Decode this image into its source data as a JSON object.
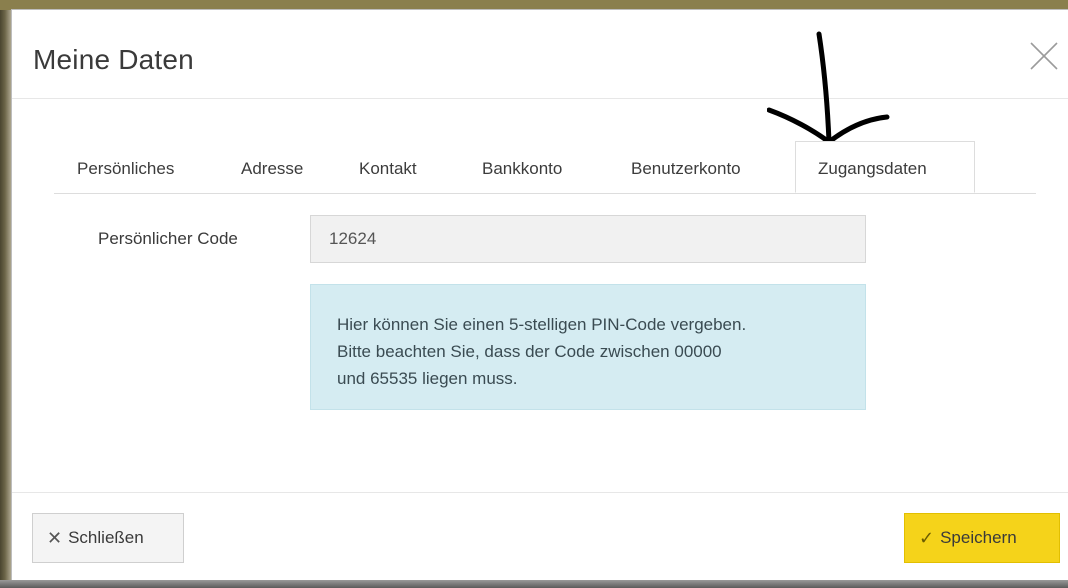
{
  "dialog": {
    "title": "Meine Daten",
    "close_icon": "close-icon"
  },
  "tabs": [
    {
      "label": "Persönliches",
      "active": false
    },
    {
      "label": "Adresse",
      "active": false
    },
    {
      "label": "Kontakt",
      "active": false
    },
    {
      "label": "Bankkonto",
      "active": false
    },
    {
      "label": "Benutzerkonto",
      "active": false
    },
    {
      "label": "Zugangsdaten",
      "active": true
    }
  ],
  "form": {
    "code_label": "Persönlicher Code",
    "code_value": "12624"
  },
  "info": {
    "line1": "Hier können Sie einen 5-stelligen PIN-Code vergeben.",
    "line2": "Bitte beachten Sie, dass der Code zwischen 00000",
    "line3": "und 65535 liegen muss."
  },
  "footer": {
    "close_label": "Schließen",
    "close_icon": "x-icon",
    "save_label": "Speichern",
    "save_icon": "check-icon"
  },
  "colors": {
    "save_button": "#f5d31a",
    "info_background": "#d5ecf2",
    "input_background": "#f1f1f1"
  },
  "annotation": {
    "icon": "hand-drawn-arrow-icon"
  }
}
